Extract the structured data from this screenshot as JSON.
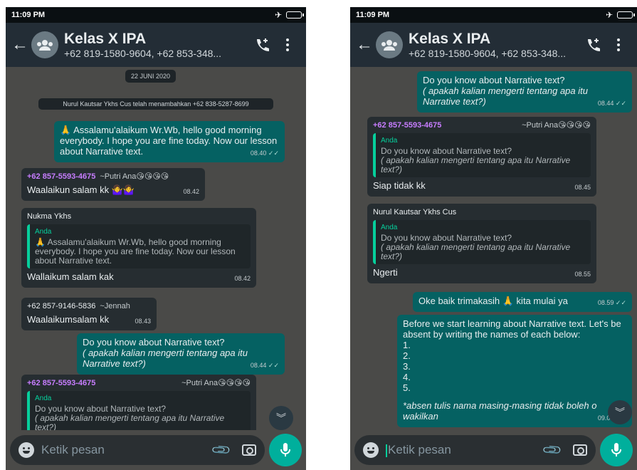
{
  "status": {
    "time": "11:09 PM"
  },
  "header": {
    "title": "Kelas X IPA",
    "subtitle": "+62 819-1580-9604, +62 853-348..."
  },
  "input": {
    "placeholder": "Ketik pesan"
  },
  "left": {
    "date_chip": "22 JUNI 2020",
    "system_note": "Nurul Kautsar Ykhs Cus telah menambahkan +62 838-5287-8699",
    "m1": {
      "text": "🙏 Assalamu'alaikum Wr.Wb, hello good morning everybody. I hope you are fine today. Now our lesson about Narrative text.",
      "time": "08.40"
    },
    "m2": {
      "sender": "+62 857-5593-4675",
      "alias": "~Putri Ana😘😘😘😘",
      "text": "Waalaikun salam kk 🤷‍♀️🤷‍♀️",
      "time": "08.42"
    },
    "m3": {
      "sender": "Nukma Ykhs",
      "quote_name": "Anda",
      "quote": "🙏 Assalamu'alaikum Wr.Wb, hello good morning everybody. I hope you are fine today. Now our lesson about Narrative text.",
      "text": "Wallaikum salam kak",
      "time": "08.42"
    },
    "m4": {
      "sender": "+62 857-9146-5836",
      "alias": "~Jennah",
      "text": "Waalaikumsalam kk",
      "time": "08.43"
    },
    "m5": {
      "line1": "Do you know about Narrative text?",
      "line2": "( apakah kalian mengerti tentang apa itu Narrative text?)",
      "time": "08.44"
    },
    "m6": {
      "sender": "+62 857-5593-4675",
      "alias": "~Putri Ana😘😘😘😘",
      "quote_name": "Anda",
      "quote1": "Do you know about Narrative text?",
      "quote2": "( apakah kalian mengerti tentang apa itu Narrative text?)"
    }
  },
  "right": {
    "m1": {
      "line1": "Do you know about Narrative text?",
      "line2": "( apakah kalian mengerti tentang apa itu Narrative text?)",
      "time": "08.44"
    },
    "m2": {
      "sender": "+62 857-5593-4675",
      "alias": "~Putri Ana😘😘😘😘",
      "quote_name": "Anda",
      "quote1": "Do you know about Narrative text?",
      "quote2": "( apakah kalian mengerti tentang apa itu Narrative text?)",
      "text": "Siap tidak kk",
      "time": "08.45"
    },
    "m3": {
      "sender": "Nurul Kautsar Ykhs Cus",
      "quote_name": "Anda",
      "quote1": "Do you know about Narrative text?",
      "quote2": "( apakah kalian mengerti tentang apa itu Narrative text?)",
      "text": "Ngerti",
      "time": "08.55"
    },
    "m4": {
      "text": "Oke baik trimakasih 🙏 kita mulai ya",
      "time": "08.59"
    },
    "m5": {
      "intro": "Before we start learning about Narrative text. Let's be absent by writing the names of each below:",
      "items": [
        "1.",
        "2.",
        "3.",
        "4.",
        "5."
      ],
      "note": "*absen  tulis nama masing-masing tidak boleh o wakilkan",
      "time": "09.00"
    }
  }
}
